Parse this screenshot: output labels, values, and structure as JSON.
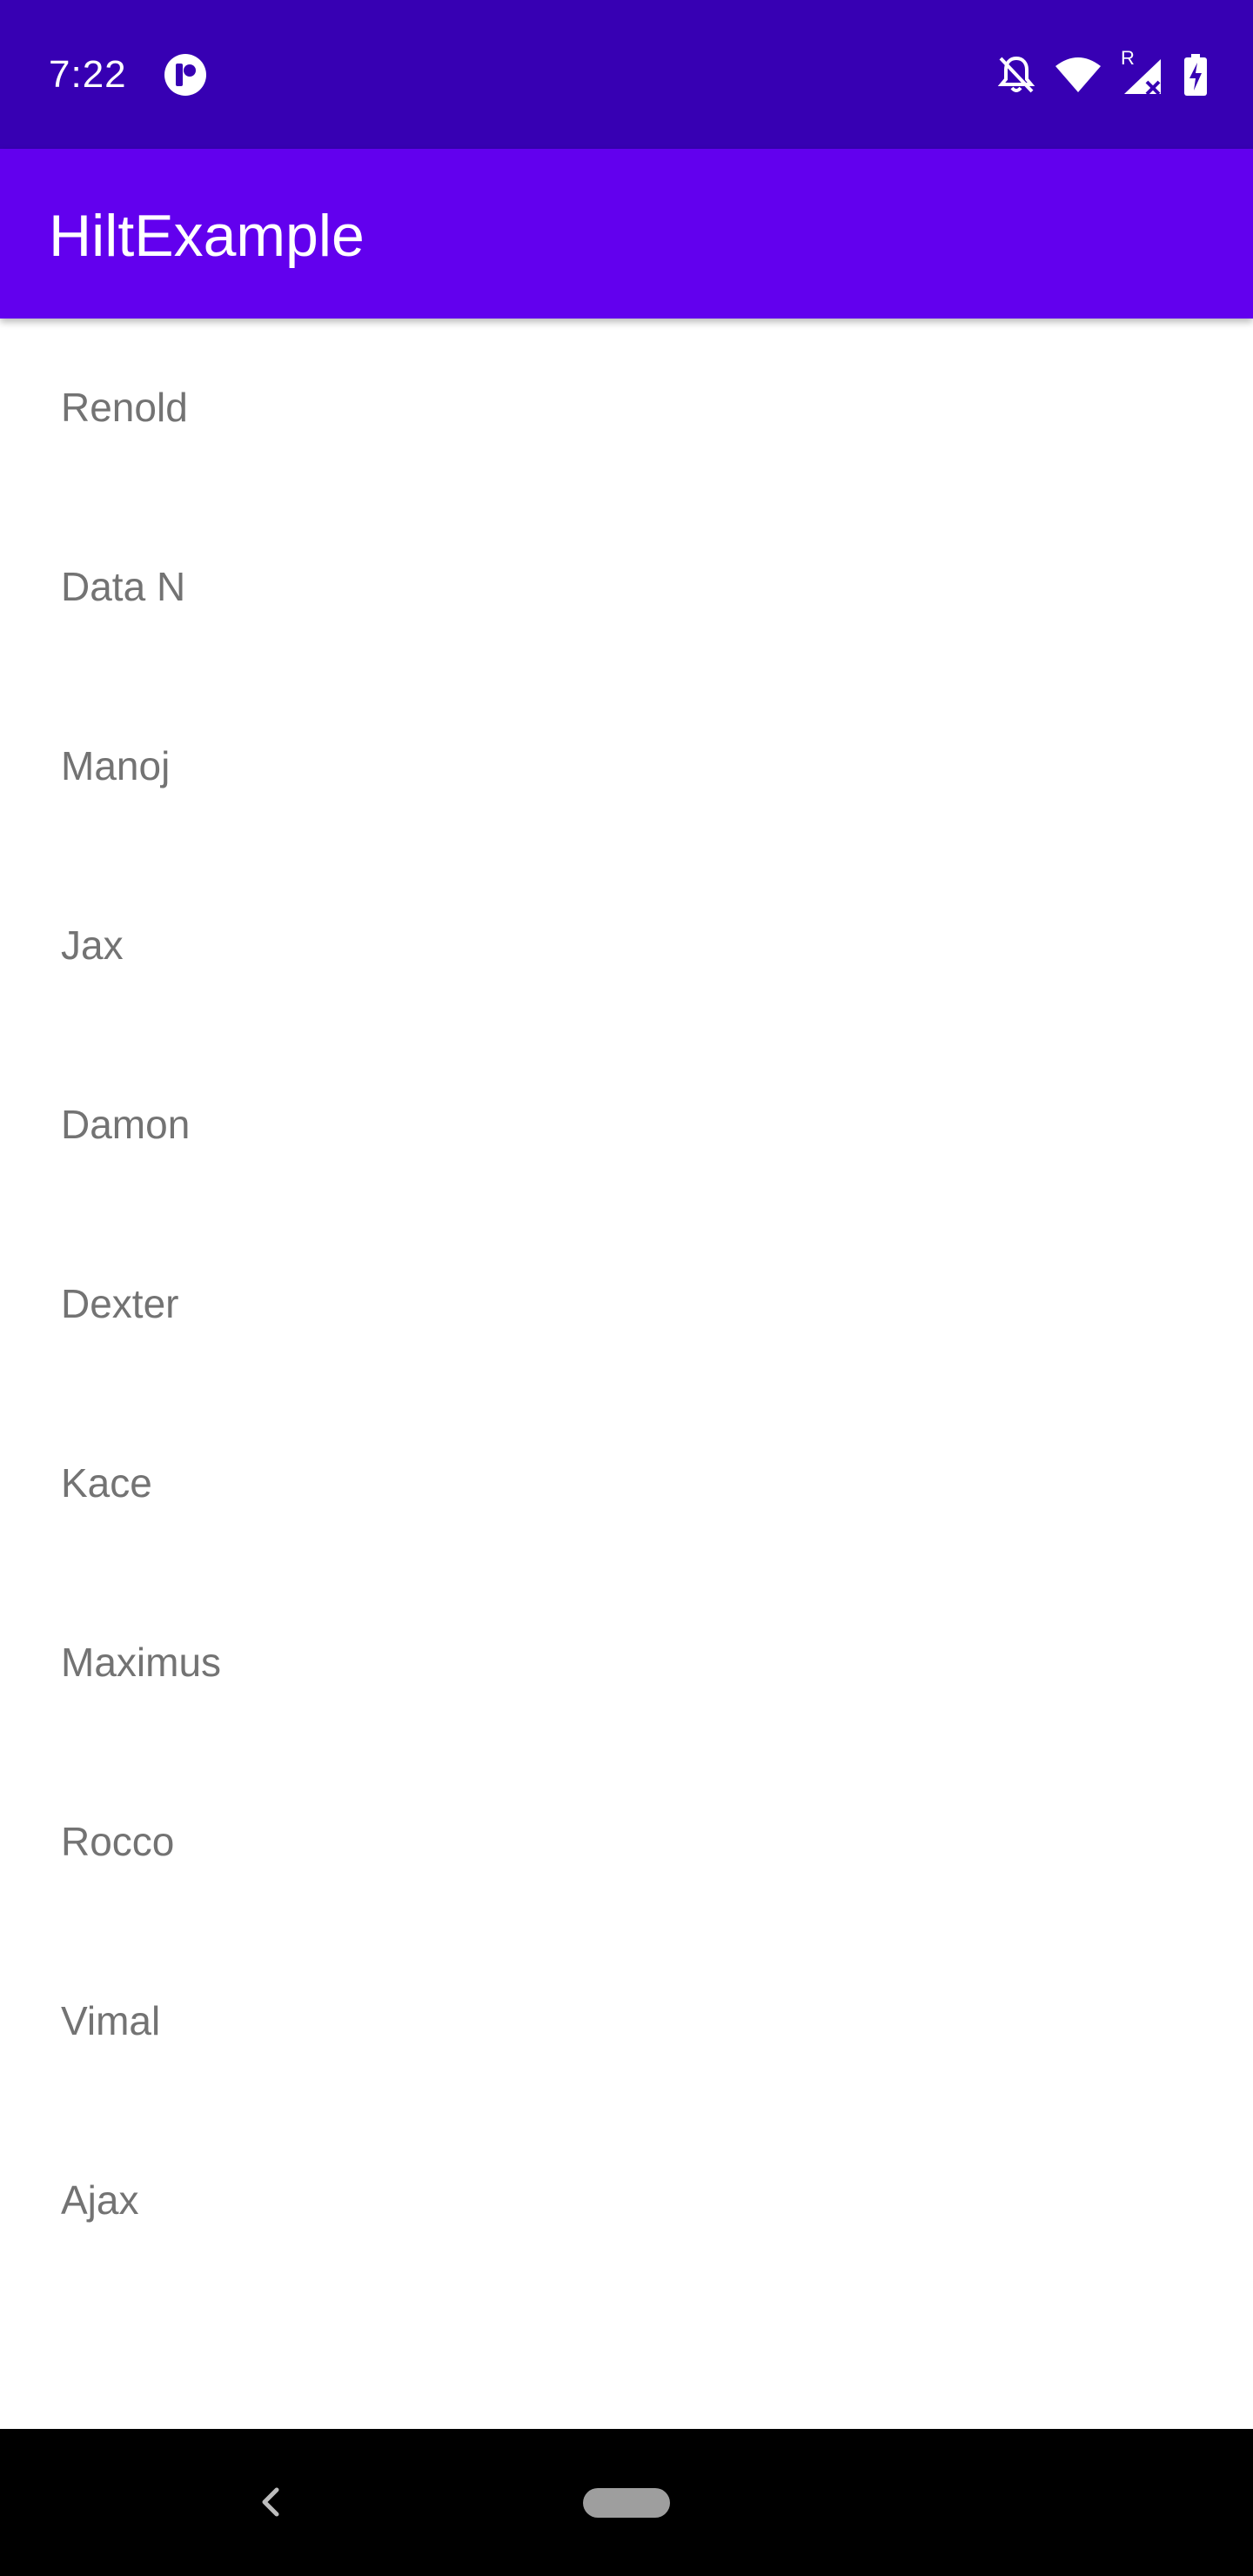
{
  "status_bar": {
    "time": "7:22",
    "background": "#3700b3",
    "icons": [
      "app-notification-icon",
      "bell-off-icon",
      "wifi-icon",
      "signal-roaming-icon",
      "battery-charging-icon"
    ],
    "roaming_label": "R"
  },
  "app_bar": {
    "title": "HiltExample",
    "background": "#6200ee"
  },
  "list": {
    "items": [
      "Renold",
      "Data N",
      "Manoj",
      "Jax",
      "Damon",
      "Dexter",
      "Kace",
      "Maximus",
      "Rocco",
      "Vimal",
      "Ajax"
    ]
  },
  "nav_bar": {
    "background": "#000000",
    "icons": [
      "back-icon",
      "home-pill-icon"
    ]
  }
}
